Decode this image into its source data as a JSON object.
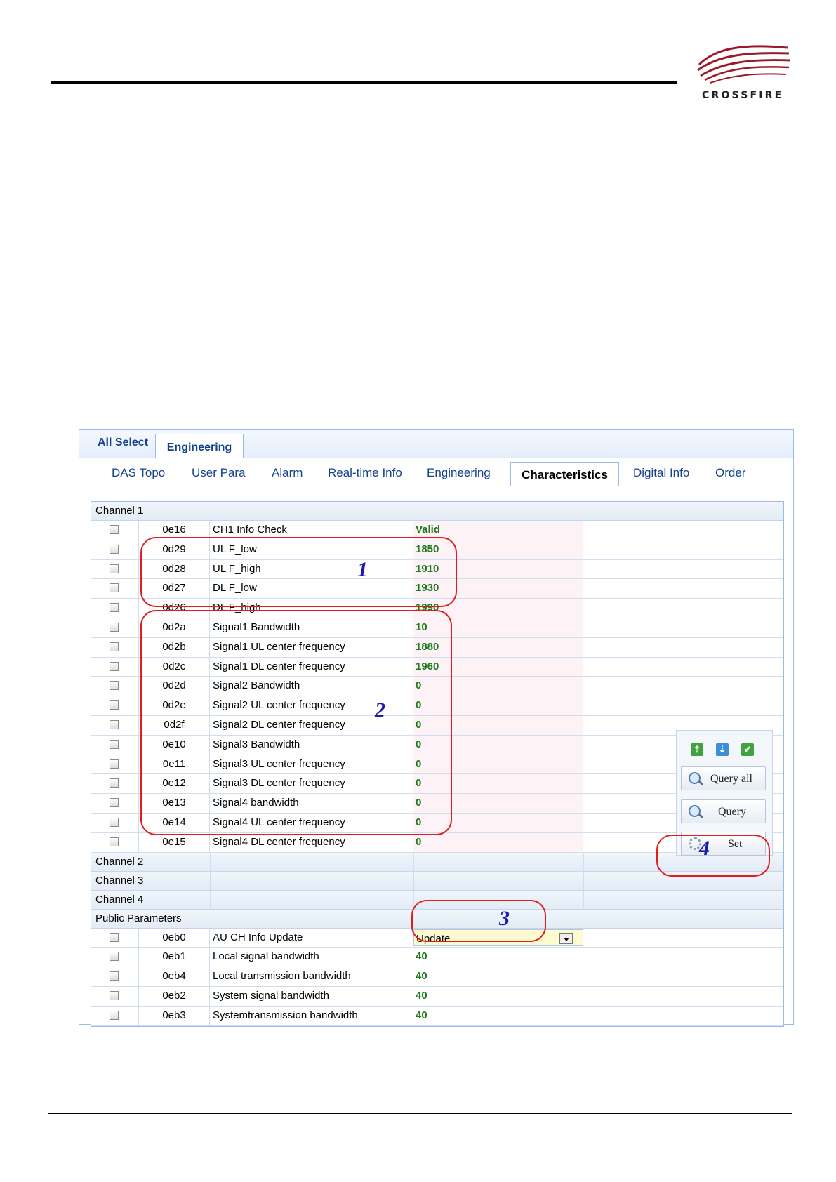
{
  "brand": {
    "name": "CROSSFIRE"
  },
  "top_tabs": [
    "All Select",
    "Engineering"
  ],
  "sub_tabs": [
    "DAS Topo",
    "User Para",
    "Alarm",
    "Real-time Info",
    "Engineering",
    "Characteristics",
    "Digital Info",
    "Order"
  ],
  "active_sub_tab": "Characteristics",
  "channel1": {
    "label": "Channel 1",
    "rows": [
      {
        "code": "0e16",
        "name": "CH1 Info Check",
        "value": "Valid"
      },
      {
        "code": "0d29",
        "name": "UL F_low",
        "value": "1850"
      },
      {
        "code": "0d28",
        "name": "UL F_high",
        "value": "1910"
      },
      {
        "code": "0d27",
        "name": "DL F_low",
        "value": "1930"
      },
      {
        "code": "0d26",
        "name": "DL F_high",
        "value": "1990"
      },
      {
        "code": "0d2a",
        "name": "Signal1 Bandwidth",
        "value": "10"
      },
      {
        "code": "0d2b",
        "name": "Signal1 UL center frequency",
        "value": "1880"
      },
      {
        "code": "0d2c",
        "name": "Signal1 DL center frequency",
        "value": "1960"
      },
      {
        "code": "0d2d",
        "name": "Signal2 Bandwidth",
        "value": "0"
      },
      {
        "code": "0d2e",
        "name": "Signal2 UL center frequency",
        "value": "0"
      },
      {
        "code": "0d2f",
        "name": "Signal2 DL center frequency",
        "value": "0"
      },
      {
        "code": "0e10",
        "name": "Signal3 Bandwidth",
        "value": "0"
      },
      {
        "code": "0e11",
        "name": "Signal3 UL center frequency",
        "value": "0"
      },
      {
        "code": "0e12",
        "name": "Signal3 DL center frequency",
        "value": "0"
      },
      {
        "code": "0e13",
        "name": "Signal4 bandwidth",
        "value": "0"
      },
      {
        "code": "0e14",
        "name": "Signal4 UL center frequency",
        "value": "0"
      },
      {
        "code": "0e15",
        "name": "Signal4 DL center frequency",
        "value": "0"
      }
    ]
  },
  "collapsed_groups": [
    "Channel 2",
    "Channel 3",
    "Channel 4"
  ],
  "public": {
    "label": "Public Parameters",
    "select_row": {
      "code": "0eb0",
      "name": "AU CH Info Update",
      "value": "Update"
    },
    "rows": [
      {
        "code": "0eb1",
        "name": "Local signal bandwidth",
        "value": "40"
      },
      {
        "code": "0eb4",
        "name": "Local transmission bandwidth",
        "value": "40"
      },
      {
        "code": "0eb2",
        "name": "System signal bandwidth",
        "value": "40"
      },
      {
        "code": "0eb3",
        "name": "Systemtransmission bandwidth",
        "value": "40"
      }
    ]
  },
  "tool_panel": {
    "icons": [
      "upload-icon",
      "download-icon",
      "check-icon"
    ],
    "query_all_label": "Query all",
    "query_label": "Query",
    "set_label": "Set"
  },
  "annotations": [
    "1",
    "2",
    "3",
    "4"
  ],
  "colors": {
    "accent": "#15428b",
    "value_green": "#1e7a1e",
    "annotation_red": "#e21b1b",
    "annotation_number": "#1a1ab0"
  }
}
